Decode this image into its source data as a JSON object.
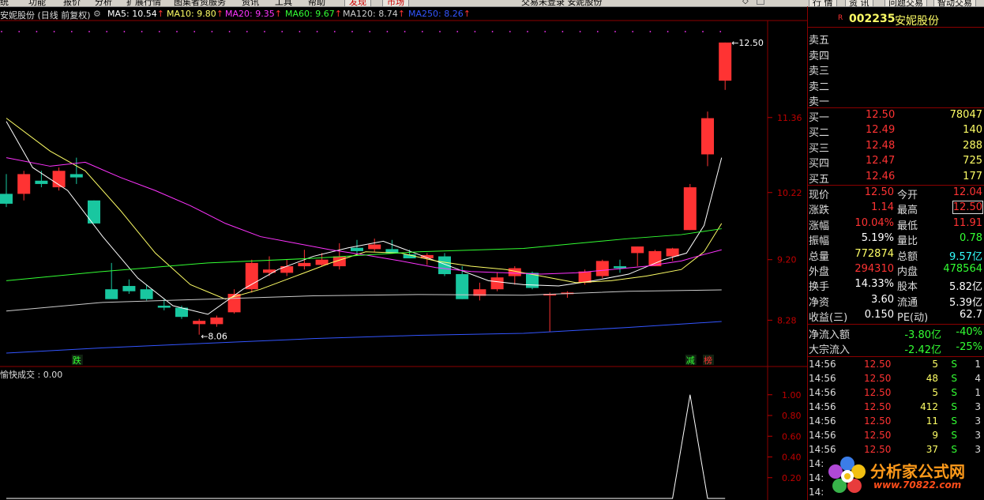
{
  "menubar": {
    "items": [
      "统",
      "功能",
      "报价",
      "分析",
      "扩展行情",
      "图集者资服务",
      "资讯",
      "工具",
      "帮助"
    ],
    "tabs": [
      "发现",
      "市场"
    ],
    "center": "交易未登录  安妮股份"
  },
  "right_topbar": {
    "buttons": [
      "行 情",
      "资 讯",
      "问题交易",
      "智动交易"
    ]
  },
  "header": {
    "name_period": "安妮股份 (日线 前复权)",
    "ma": [
      {
        "label": "MA5: 10.54",
        "color": "#ffffff"
      },
      {
        "label": "MA10: 9.80",
        "color": "#ffff66"
      },
      {
        "label": "MA20: 9.35",
        "color": "#ff33ff"
      },
      {
        "label": "MA60: 9.67",
        "color": "#33ff33"
      },
      {
        "label": "MA120: 8.74",
        "color": "#cccccc"
      },
      {
        "label": "MA250: 8.26",
        "color": "#3355ff"
      }
    ],
    "up_arrow": "↑"
  },
  "chart_data": [
    {
      "type": "candlestick",
      "title": "安妮股份 (日线 前复权)",
      "y_ticks": [
        8.28,
        9.2,
        10.22,
        11.36
      ],
      "ylim": [
        7.6,
        12.75
      ],
      "candles": [
        {
          "o": 10.2,
          "h": 10.5,
          "l": 10.0,
          "c": 10.05
        },
        {
          "o": 10.2,
          "h": 10.55,
          "l": 10.1,
          "c": 10.5
        },
        {
          "o": 10.4,
          "h": 10.55,
          "l": 10.3,
          "c": 10.35
        },
        {
          "o": 10.3,
          "h": 10.6,
          "l": 10.25,
          "c": 10.55
        },
        {
          "o": 10.5,
          "h": 10.75,
          "l": 10.35,
          "c": 10.45
        },
        {
          "o": 10.1,
          "h": 10.1,
          "l": 9.75,
          "c": 9.75
        },
        {
          "o": 8.75,
          "h": 9.15,
          "l": 8.62,
          "c": 8.6
        },
        {
          "o": 8.8,
          "h": 8.9,
          "l": 8.68,
          "c": 8.72
        },
        {
          "o": 8.75,
          "h": 8.82,
          "l": 8.58,
          "c": 8.6
        },
        {
          "o": 8.5,
          "h": 8.6,
          "l": 8.43,
          "c": 8.47
        },
        {
          "o": 8.47,
          "h": 8.5,
          "l": 8.3,
          "c": 8.33
        },
        {
          "o": 8.22,
          "h": 8.3,
          "l": 8.06,
          "c": 8.27
        },
        {
          "o": 8.22,
          "h": 8.35,
          "l": 8.18,
          "c": 8.32
        },
        {
          "o": 8.4,
          "h": 8.75,
          "l": 8.38,
          "c": 8.68
        },
        {
          "o": 8.75,
          "h": 9.2,
          "l": 8.7,
          "c": 9.15
        },
        {
          "o": 9.0,
          "h": 9.25,
          "l": 8.95,
          "c": 9.05
        },
        {
          "o": 9.0,
          "h": 9.2,
          "l": 8.95,
          "c": 9.1
        },
        {
          "o": 9.1,
          "h": 9.35,
          "l": 9.05,
          "c": 9.15
        },
        {
          "o": 9.12,
          "h": 9.3,
          "l": 9.1,
          "c": 9.2
        },
        {
          "o": 9.1,
          "h": 9.45,
          "l": 9.05,
          "c": 9.25
        },
        {
          "o": 9.38,
          "h": 9.5,
          "l": 9.28,
          "c": 9.33
        },
        {
          "o": 9.36,
          "h": 9.52,
          "l": 9.32,
          "c": 9.43
        },
        {
          "o": 9.36,
          "h": 9.5,
          "l": 9.3,
          "c": 9.3
        },
        {
          "o": 9.28,
          "h": 9.35,
          "l": 9.22,
          "c": 9.22
        },
        {
          "o": 9.22,
          "h": 9.3,
          "l": 9.12,
          "c": 9.27
        },
        {
          "o": 9.25,
          "h": 9.3,
          "l": 8.95,
          "c": 8.98
        },
        {
          "o": 8.98,
          "h": 9.1,
          "l": 8.6,
          "c": 8.6
        },
        {
          "o": 8.65,
          "h": 8.85,
          "l": 8.58,
          "c": 8.75
        },
        {
          "o": 8.75,
          "h": 9.0,
          "l": 8.72,
          "c": 8.93
        },
        {
          "o": 8.95,
          "h": 9.1,
          "l": 8.82,
          "c": 9.07
        },
        {
          "o": 9.0,
          "h": 9.02,
          "l": 8.75,
          "c": 8.77
        },
        {
          "o": 8.67,
          "h": 8.7,
          "l": 8.1,
          "c": 8.68
        },
        {
          "o": 8.68,
          "h": 8.72,
          "l": 8.62,
          "c": 8.7
        },
        {
          "o": 8.85,
          "h": 9.05,
          "l": 8.82,
          "c": 9.02
        },
        {
          "o": 8.95,
          "h": 9.2,
          "l": 8.92,
          "c": 9.18
        },
        {
          "o": 9.1,
          "h": 9.2,
          "l": 9.0,
          "c": 9.07
        },
        {
          "o": 9.3,
          "h": 9.4,
          "l": 9.1,
          "c": 9.4
        },
        {
          "o": 9.1,
          "h": 9.35,
          "l": 9.1,
          "c": 9.33
        },
        {
          "o": 9.25,
          "h": 9.38,
          "l": 9.18,
          "c": 9.37
        },
        {
          "o": 9.65,
          "h": 10.35,
          "l": 9.65,
          "c": 10.3
        },
        {
          "o": 10.8,
          "h": 11.45,
          "l": 10.62,
          "c": 11.35
        },
        {
          "o": 11.92,
          "h": 12.5,
          "l": 11.78,
          "c": 12.5
        }
      ],
      "ma_lines": [
        {
          "name": "MA5",
          "color": "#ffffff",
          "points": [
            [
              0,
              11.3
            ],
            [
              1.5,
              10.6
            ],
            [
              3.5,
              10.25
            ],
            [
              5.5,
              9.55
            ],
            [
              7.5,
              8.92
            ],
            [
              9.5,
              8.5
            ],
            [
              11.5,
              8.37
            ],
            [
              13.5,
              8.75
            ],
            [
              15.5,
              9.05
            ],
            [
              17.5,
              9.25
            ],
            [
              19.5,
              9.38
            ],
            [
              21.5,
              9.48
            ],
            [
              23.5,
              9.28
            ],
            [
              25.5,
              9.08
            ],
            [
              27.5,
              8.88
            ],
            [
              29.5,
              8.82
            ],
            [
              31.5,
              8.8
            ],
            [
              33.5,
              8.88
            ],
            [
              35.5,
              8.98
            ],
            [
              37.5,
              9.2
            ],
            [
              38.8,
              9.3
            ],
            [
              39.8,
              9.72
            ],
            [
              40.8,
              10.75
            ]
          ]
        },
        {
          "name": "MA10",
          "color": "#ffff66",
          "points": [
            [
              0,
              11.35
            ],
            [
              2.5,
              10.85
            ],
            [
              4.5,
              10.55
            ],
            [
              6.5,
              9.95
            ],
            [
              8.5,
              9.3
            ],
            [
              10.5,
              8.82
            ],
            [
              12.5,
              8.6
            ],
            [
              14.5,
              8.75
            ],
            [
              16.5,
              8.95
            ],
            [
              18.5,
              9.15
            ],
            [
              20.5,
              9.32
            ],
            [
              22.5,
              9.3
            ],
            [
              24.5,
              9.18
            ],
            [
              26.5,
              9.1
            ],
            [
              28.5,
              9.05
            ],
            [
              30.5,
              8.95
            ],
            [
              32.5,
              8.85
            ],
            [
              34.5,
              8.88
            ],
            [
              36.5,
              8.95
            ],
            [
              38.5,
              9.05
            ],
            [
              39.8,
              9.32
            ],
            [
              40.8,
              9.75
            ]
          ]
        },
        {
          "name": "MA20",
          "color": "#ff33ff",
          "points": [
            [
              0,
              10.75
            ],
            [
              2.5,
              10.62
            ],
            [
              4.5,
              10.68
            ],
            [
              6.5,
              10.45
            ],
            [
              8.5,
              10.25
            ],
            [
              10.5,
              10.02
            ],
            [
              12.5,
              9.75
            ],
            [
              14.5,
              9.55
            ],
            [
              16.5,
              9.45
            ],
            [
              18.5,
              9.35
            ],
            [
              20.5,
              9.27
            ],
            [
              22.5,
              9.18
            ],
            [
              24.5,
              9.08
            ],
            [
              26.5,
              9.02
            ],
            [
              28.5,
              9.0
            ],
            [
              30.5,
              8.98
            ],
            [
              32.5,
              9.0
            ],
            [
              34.5,
              9.05
            ],
            [
              36.5,
              9.1
            ],
            [
              38.5,
              9.18
            ],
            [
              39.8,
              9.28
            ],
            [
              40.8,
              9.35
            ]
          ]
        },
        {
          "name": "MA60",
          "color": "#33ff33",
          "points": [
            [
              0,
              8.88
            ],
            [
              5.5,
              9.02
            ],
            [
              11.5,
              9.15
            ],
            [
              17.5,
              9.22
            ],
            [
              23.5,
              9.32
            ],
            [
              29.5,
              9.37
            ],
            [
              35.5,
              9.52
            ],
            [
              38.5,
              9.58
            ],
            [
              40.8,
              9.67
            ]
          ]
        },
        {
          "name": "MA120",
          "color": "#cccccc",
          "points": [
            [
              0,
              8.42
            ],
            [
              5.5,
              8.55
            ],
            [
              11.5,
              8.6
            ],
            [
              17.5,
              8.65
            ],
            [
              23.5,
              8.67
            ],
            [
              29.5,
              8.66
            ],
            [
              35.5,
              8.72
            ],
            [
              40.8,
              8.74
            ]
          ]
        },
        {
          "name": "MA250",
          "color": "#3355ff",
          "points": [
            [
              0,
              7.78
            ],
            [
              5.5,
              7.86
            ],
            [
              11.5,
              7.93
            ],
            [
              17.5,
              8.0
            ],
            [
              23.5,
              8.05
            ],
            [
              29.5,
              8.08
            ],
            [
              35.5,
              8.17
            ],
            [
              40.8,
              8.26
            ]
          ]
        }
      ],
      "annotations": [
        {
          "text": "←8.06",
          "candle": 11
        },
        {
          "text": "←12.50",
          "candle": 41
        }
      ],
      "markers": [
        {
          "text": "跌",
          "candle": 4,
          "color": "#33ff33"
        },
        {
          "text": "减",
          "candle": 39,
          "color": "#33ff33"
        },
        {
          "text": "榜",
          "candle": 40,
          "color": "#ff3333"
        }
      ]
    },
    {
      "type": "line",
      "title": "愉快成交 : 0.00",
      "y_ticks": [
        0.2,
        0.4,
        0.6,
        0.8,
        1.0
      ],
      "ylim": [
        0,
        1.12
      ],
      "values": [
        0,
        0,
        0,
        0,
        0,
        0,
        0,
        0,
        0,
        0,
        0,
        0,
        0,
        0,
        0,
        0,
        0,
        0,
        0,
        0,
        0,
        0,
        0,
        0,
        0,
        0,
        0,
        0,
        0,
        0,
        0,
        0,
        0,
        0,
        0,
        0,
        0,
        0,
        0,
        1,
        0,
        0
      ]
    }
  ],
  "side": {
    "code_prefix": "R",
    "code": "002235",
    "name": "安妮股份",
    "sell_labels": [
      "卖五",
      "卖四",
      "卖三",
      "卖二",
      "卖一"
    ],
    "buy": [
      {
        "label": "买一",
        "price": "12.50",
        "vol": "78047"
      },
      {
        "label": "买二",
        "price": "12.49",
        "vol": "140"
      },
      {
        "label": "买三",
        "price": "12.48",
        "vol": "288"
      },
      {
        "label": "买四",
        "price": "12.47",
        "vol": "725"
      },
      {
        "label": "买五",
        "price": "12.46",
        "vol": "177"
      }
    ],
    "stats": [
      {
        "l1": "现价",
        "v1": "12.50",
        "c1": "#ff3333",
        "l2": "今开",
        "v2": "12.04",
        "c2": "#ff3333"
      },
      {
        "l1": "涨跌",
        "v1": "1.14",
        "c1": "#ff3333",
        "l2": "最高",
        "v2": "12.50",
        "c2": "#ff3333",
        "box2": true
      },
      {
        "l1": "涨幅",
        "v1": "10.04%",
        "c1": "#ff3333",
        "l2": "最低",
        "v2": "11.91",
        "c2": "#ff3333"
      },
      {
        "l1": "振幅",
        "v1": "5.19%",
        "c1": "#ffffff",
        "l2": "量比",
        "v2": "0.78",
        "c2": "#33ff33"
      },
      {
        "l1": "总量",
        "v1": "772874",
        "c1": "#ffff66",
        "l2": "总额",
        "v2": "9.57亿",
        "c2": "#33ffff"
      },
      {
        "l1": "外盘",
        "v1": "294310",
        "c1": "#ff3333",
        "l2": "内盘",
        "v2": "478564",
        "c2": "#33ff33"
      },
      {
        "l1": "换手",
        "v1": "14.33%",
        "c1": "#ffffff",
        "l2": "股本",
        "v2": "5.82亿",
        "c2": "#ffffff"
      },
      {
        "l1": "净资",
        "v1": "3.60",
        "c1": "#ffffff",
        "l2": "流通",
        "v2": "5.39亿",
        "c2": "#ffffff"
      },
      {
        "l1": "收益(三)",
        "v1": "0.150",
        "c1": "#ffffff",
        "l2": "PE(动)",
        "v2": "62.7",
        "c2": "#ffffff"
      }
    ],
    "flows": [
      {
        "label": "净流入额",
        "value": "-3.80亿",
        "pct": "-40%"
      },
      {
        "label": "大宗流入",
        "value": "-2.42亿",
        "pct": "-25%"
      }
    ],
    "ticks": [
      {
        "time": "14:56",
        "price": "12.50",
        "vol": "5",
        "vcolor": "#ffff66",
        "bs": "S",
        "n": "1"
      },
      {
        "time": "14:56",
        "price": "12.50",
        "vol": "48",
        "vcolor": "#ffff66",
        "bs": "S",
        "n": "4"
      },
      {
        "time": "14:56",
        "price": "12.50",
        "vol": "5",
        "vcolor": "#ffff66",
        "bs": "S",
        "n": "1"
      },
      {
        "time": "14:56",
        "price": "12.50",
        "vol": "412",
        "vcolor": "#ffff66",
        "bs": "S",
        "n": "3"
      },
      {
        "time": "14:56",
        "price": "12.50",
        "vol": "11",
        "vcolor": "#ffff66",
        "bs": "S",
        "n": "3"
      },
      {
        "time": "14:56",
        "price": "12.50",
        "vol": "9",
        "vcolor": "#ffff66",
        "bs": "S",
        "n": "3"
      },
      {
        "time": "14:56",
        "price": "12.50",
        "vol": "37",
        "vcolor": "#ffff66",
        "bs": "S",
        "n": "3"
      },
      {
        "time": "14:",
        "price": "",
        "vol": "",
        "vcolor": "#ffff66",
        "bs": "",
        "n": ""
      },
      {
        "time": "14:",
        "price": "",
        "vol": "",
        "vcolor": "#ffff66",
        "bs": "",
        "n": ""
      },
      {
        "time": "14:",
        "price": "",
        "vol": "",
        "vcolor": "#ffff66",
        "bs": "",
        "n": ""
      }
    ]
  },
  "watermark": {
    "text1": "分析家公式网",
    "text2": "www.70822.com"
  }
}
